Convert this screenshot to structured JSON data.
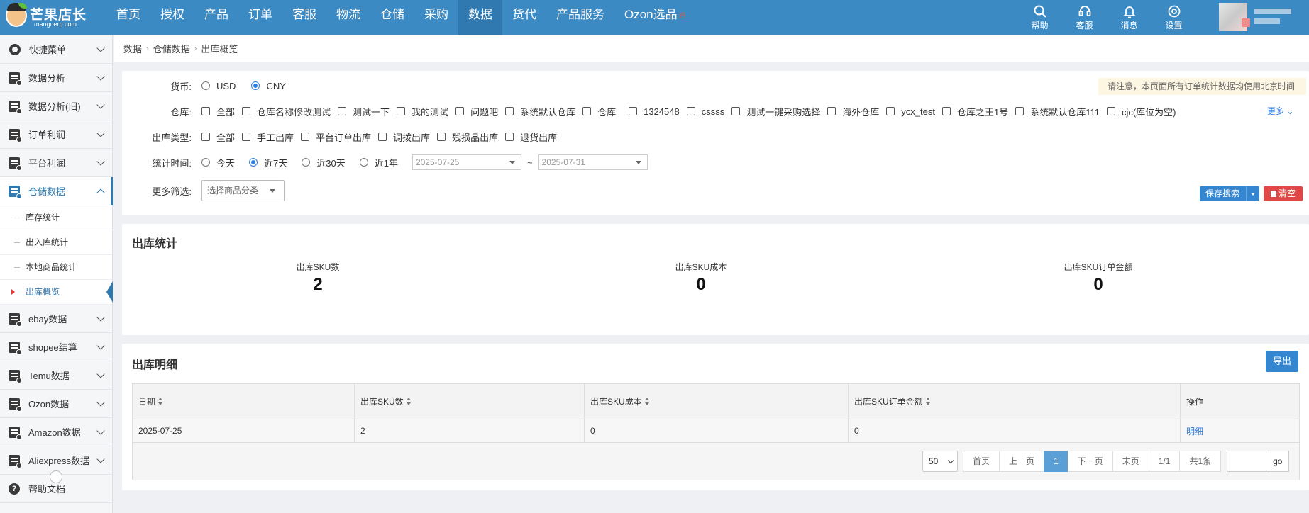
{
  "brand": {
    "name": "芒果店长",
    "domain": "mangoerp.com"
  },
  "nav": {
    "items": [
      {
        "label": "首页"
      },
      {
        "label": "授权"
      },
      {
        "label": "产品"
      },
      {
        "label": "订单"
      },
      {
        "label": "客服"
      },
      {
        "label": "物流"
      },
      {
        "label": "仓储"
      },
      {
        "label": "采购"
      },
      {
        "label": "数据",
        "active": true
      },
      {
        "label": "货代"
      },
      {
        "label": "产品服务"
      },
      {
        "label": "Ozon选品",
        "hot": true
      }
    ],
    "tools": [
      {
        "label": "帮助",
        "icon": "search-icon"
      },
      {
        "label": "客服",
        "icon": "headset-icon"
      },
      {
        "label": "消息",
        "icon": "bell-icon"
      },
      {
        "label": "设置",
        "icon": "gear-icon"
      }
    ]
  },
  "sidebar": {
    "items": [
      {
        "label": "快捷菜单",
        "icon": "gear-icon"
      },
      {
        "label": "数据分析",
        "icon": "database-icon"
      },
      {
        "label": "数据分析(旧)",
        "icon": "database-icon"
      },
      {
        "label": "订单利润",
        "icon": "database-icon"
      },
      {
        "label": "平台利润",
        "icon": "database-icon"
      },
      {
        "label": "仓储数据",
        "icon": "database-icon",
        "open": true
      }
    ],
    "subitems": [
      {
        "label": "库存统计"
      },
      {
        "label": "出入库统计"
      },
      {
        "label": "本地商品统计"
      },
      {
        "label": "出库概览",
        "active": true
      }
    ],
    "items_after": [
      {
        "label": "ebay数据"
      },
      {
        "label": "shopee结算"
      },
      {
        "label": "Temu数据"
      },
      {
        "label": "Ozon数据"
      },
      {
        "label": "Amazon数据"
      },
      {
        "label": "Aliexpress数据"
      }
    ],
    "help": "帮助文档"
  },
  "breadcrumb": [
    "数据",
    "仓储数据",
    "出库概览"
  ],
  "filter": {
    "currency_label": "货币:",
    "currency_options": [
      {
        "label": "USD",
        "checked": false
      },
      {
        "label": "CNY",
        "checked": true
      }
    ],
    "warehouse_label": "仓库:",
    "warehouse_options": [
      "全部",
      "仓库名称修改测试",
      "测试一下",
      "我的测试",
      "问题吧",
      "系统默认仓库",
      "仓库",
      "1324548",
      "cssss",
      "测试一键采购选择",
      "海外仓库",
      "ycx_test",
      "仓库之王1号",
      "系统默认仓库111",
      "cjc(库位为空)"
    ],
    "more": "更多",
    "type_label": "出库类型:",
    "type_options": [
      "全部",
      "手工出库",
      "平台订单出库",
      "调拨出库",
      "残损品出库",
      "退货出库"
    ],
    "time_label": "统计时间:",
    "time_options": [
      {
        "label": "今天",
        "checked": false
      },
      {
        "label": "近7天",
        "checked": true
      },
      {
        "label": "近30天",
        "checked": false
      },
      {
        "label": "近1年",
        "checked": false
      }
    ],
    "date_start": "2025-07-25",
    "date_sep": "~",
    "date_end": "2025-07-31",
    "more_filter_label": "更多筛选:",
    "category_placeholder": "选择商品分类",
    "notice": "请注意，本页面所有订单统计数据均使用北京时间",
    "save_label": "保存搜索",
    "clear_label": "清空"
  },
  "stats": {
    "title": "出库统计",
    "items": [
      {
        "label": "出库SKU数",
        "value": "2"
      },
      {
        "label": "出库SKU成本",
        "value": "0"
      },
      {
        "label": "出库SKU订单金额",
        "value": "0"
      }
    ]
  },
  "detail": {
    "title": "出库明细",
    "export_label": "导出",
    "columns": [
      "日期",
      "出库SKU数",
      "出库SKU成本",
      "出库SKU订单金额",
      "操作"
    ],
    "rows": [
      {
        "date": "2025-07-25",
        "sku": "2",
        "cost": "0",
        "amount": "0",
        "action": "明细"
      }
    ],
    "pager": {
      "size": "50",
      "first": "首页",
      "prev": "上一页",
      "current": "1",
      "next": "下一页",
      "last": "末页",
      "pages": "1/1",
      "total": "共1条",
      "go": "go"
    }
  }
}
